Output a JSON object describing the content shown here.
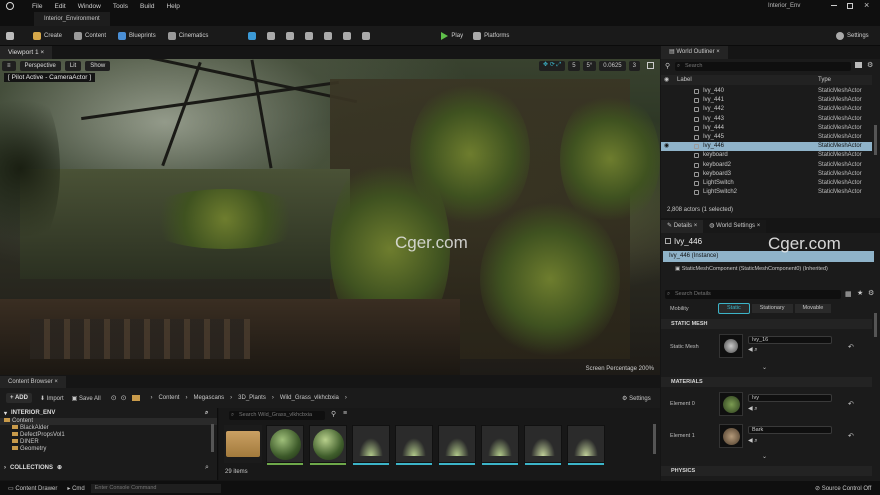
{
  "menu": {
    "items": [
      "File",
      "Edit",
      "Window",
      "Tools",
      "Build",
      "Help"
    ],
    "project": "Interior_Env"
  },
  "level_tab": "Interior_Environment",
  "toolbar": {
    "create": "Create",
    "content": "Content",
    "blueprints": "Blueprints",
    "cinematics": "Cinematics",
    "play": "Play",
    "platforms": "Platforms",
    "settings": "Settings"
  },
  "viewport": {
    "tab": "Viewport 1",
    "perspective": "Perspective",
    "lit": "Lit",
    "show": "Show",
    "pilot": "[ Pilot Active - CameraActor ]",
    "snap_grid": "5",
    "snap_angle": "5°",
    "snap_scale": "0.0625",
    "cam_speed": "3",
    "screen_percentage": "Screen Percentage  200%",
    "watermark": "Cger.com"
  },
  "content_browser": {
    "tabs": [
      "Content Browser"
    ],
    "add": "ADD",
    "import": "Import",
    "save_all": "Save All",
    "breadcrumb": [
      "Content",
      "Megascans",
      "3D_Plants",
      "Wild_Grass_vlkhcbxia"
    ],
    "settings": "Settings",
    "root": "INTERIOR_ENV",
    "tree": [
      "Content",
      "BlackAlder",
      "DefectPropsVol1",
      "DINER",
      "Geometry"
    ],
    "collections": "COLLECTIONS",
    "search_placeholder": "Search Wild_Grass_vlkhcbxia",
    "item_count": "29 items",
    "thumbs": [
      "folder",
      "sphere",
      "sphere",
      "grass",
      "grass",
      "grass",
      "grass",
      "grass",
      "grass"
    ]
  },
  "status_bar": {
    "drawer": "Content Drawer",
    "cmd": "Cmd",
    "console_placeholder": "Enter Console Command",
    "source_control": "Source Control Off"
  },
  "outliner": {
    "tab": "World Outliner",
    "search_placeholder": "Search",
    "col_label": "Label",
    "col_type": "Type",
    "rows": [
      {
        "label": "Ivy_440",
        "type": "StaticMeshActor",
        "selected": false
      },
      {
        "label": "Ivy_441",
        "type": "StaticMeshActor",
        "selected": false
      },
      {
        "label": "Ivy_442",
        "type": "StaticMeshActor",
        "selected": false
      },
      {
        "label": "Ivy_443",
        "type": "StaticMeshActor",
        "selected": false
      },
      {
        "label": "Ivy_444",
        "type": "StaticMeshActor",
        "selected": false
      },
      {
        "label": "Ivy_445",
        "type": "StaticMeshActor",
        "selected": false
      },
      {
        "label": "Ivy_446",
        "type": "StaticMeshActor",
        "selected": true
      },
      {
        "label": "keyboard",
        "type": "StaticMeshActor",
        "selected": false
      },
      {
        "label": "keyboard2",
        "type": "StaticMeshActor",
        "selected": false
      },
      {
        "label": "keyboard3",
        "type": "StaticMeshActor",
        "selected": false
      },
      {
        "label": "LightSwitch",
        "type": "StaticMeshActor",
        "selected": false
      },
      {
        "label": "LightSwitch2",
        "type": "StaticMeshActor",
        "selected": false
      }
    ],
    "footer": "2,808 actors (1 selected)"
  },
  "details": {
    "tabs": [
      "Details",
      "World Settings"
    ],
    "actor": "Ivy_446",
    "instance": "Ivy_446 (Instance)",
    "component": "StaticMeshComponent (StaticMeshComponent0) (Inherited)",
    "search_placeholder": "Search Details",
    "mobility_label": "Mobility",
    "mobility": [
      "Static",
      "Stationary",
      "Movable"
    ],
    "sec_static_mesh": "STATIC MESH",
    "static_mesh_label": "Static Mesh",
    "static_mesh_value": "Ivy_16",
    "sec_materials": "MATERIALS",
    "element0": "Element 0",
    "element0_value": "Ivy",
    "element1": "Element 1",
    "element1_value": "Bark",
    "sec_physics": "PHYSICS",
    "watermark": "Cger.com"
  },
  "colors": {
    "accent": "#3cb4c8",
    "selection": "#8fb3c9",
    "play": "#5fbf4a",
    "folder": "#c89a4a"
  }
}
